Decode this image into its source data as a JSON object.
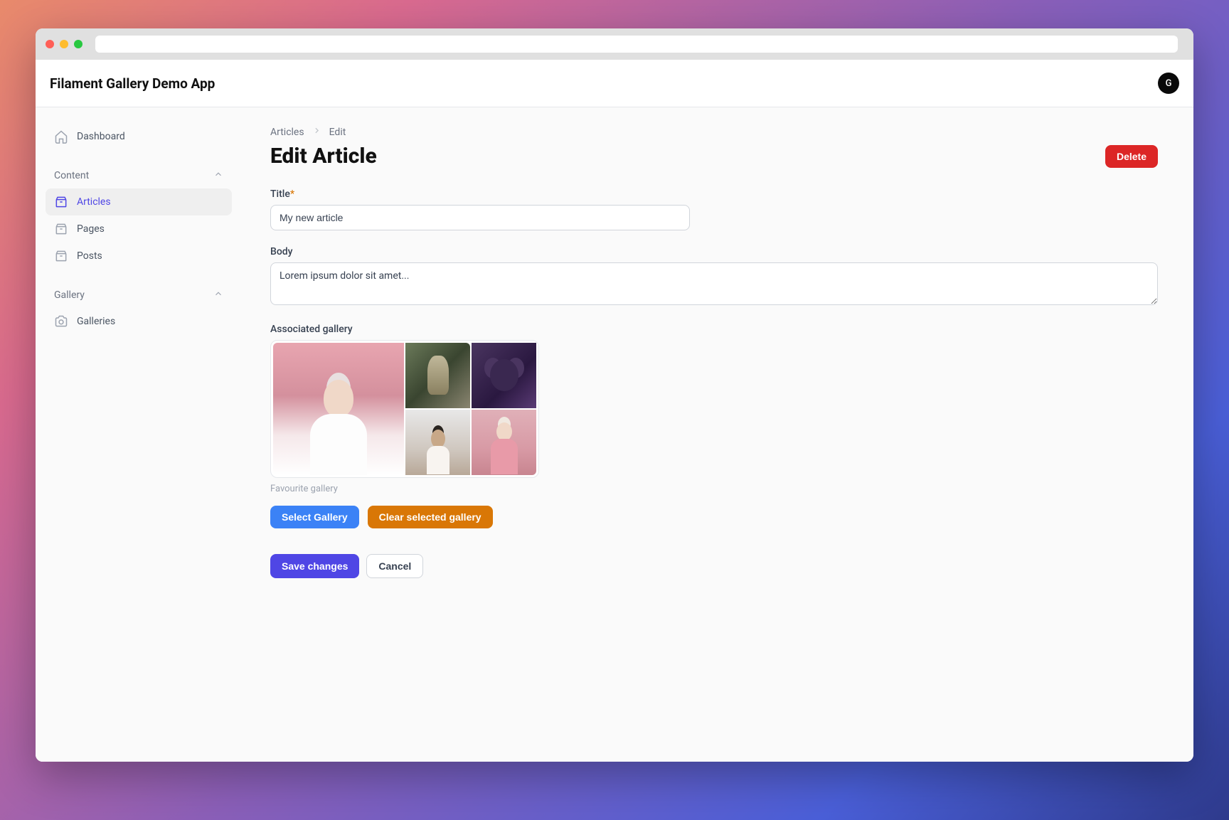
{
  "header": {
    "appTitle": "Filament Gallery Demo App",
    "avatarLetter": "G"
  },
  "sidebar": {
    "dashboard": "Dashboard",
    "groups": {
      "content": {
        "label": "Content",
        "items": {
          "articles": "Articles",
          "pages": "Pages",
          "posts": "Posts"
        }
      },
      "gallery": {
        "label": "Gallery",
        "items": {
          "galleries": "Galleries"
        }
      }
    }
  },
  "breadcrumb": {
    "parent": "Articles",
    "current": "Edit"
  },
  "page": {
    "title": "Edit Article",
    "deleteLabel": "Delete"
  },
  "form": {
    "titleLabel": "Title",
    "titleValue": "My new article",
    "bodyLabel": "Body",
    "bodyValue": "Lorem ipsum dolor sit amet...",
    "galleryLabel": "Associated gallery",
    "galleryCaption": "Favourite gallery",
    "selectGalleryLabel": "Select Gallery",
    "clearGalleryLabel": "Clear selected gallery",
    "saveLabel": "Save changes",
    "cancelLabel": "Cancel"
  }
}
